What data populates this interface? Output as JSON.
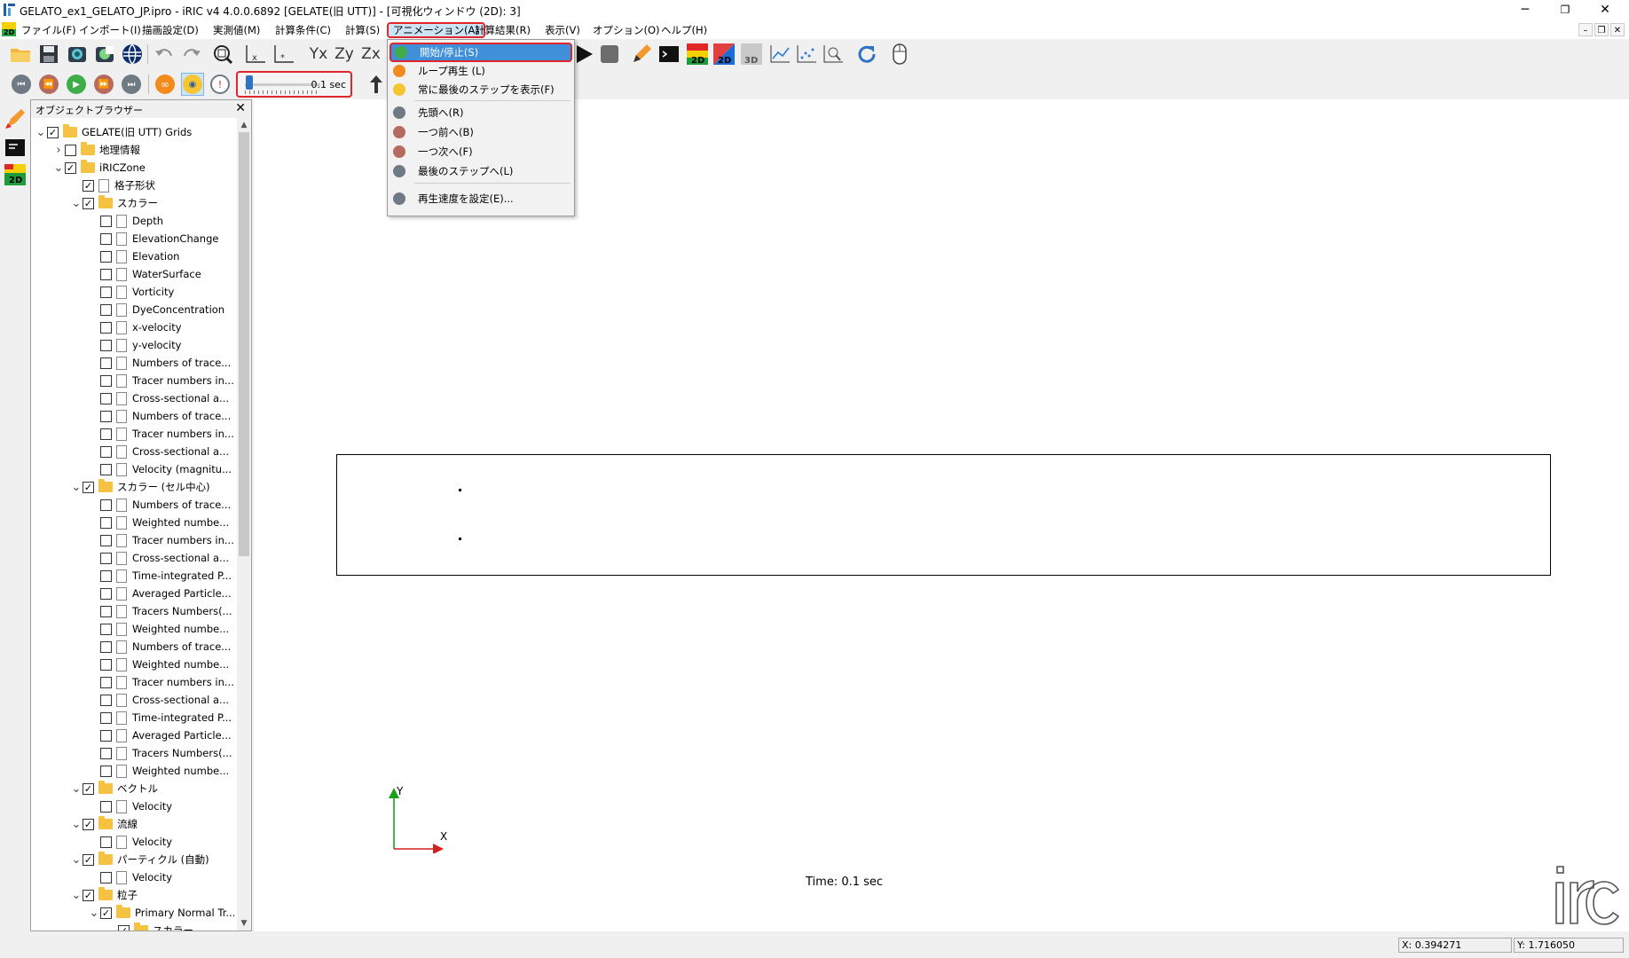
{
  "window": {
    "title": "GELATO_ex1_GELATO_JP.ipro - iRIC v4 4.0.0.6892 [GELATE(旧 UTT)] - [可視化ウィンドウ (2D): 3]",
    "minimize": "─",
    "maximize": "❐",
    "close": "✕"
  },
  "menubar": {
    "items": [
      "ファイル(F)",
      "インポート(I)",
      "描画設定(D)",
      "実測値(M)",
      "計算条件(C)",
      "計算(S)",
      "アニメーション(A)",
      "計算結果(R)",
      "表示(V)",
      "オプション(O)",
      "ヘルプ(H)"
    ],
    "active": "アニメーション(A)",
    "mdi_controls": [
      "–",
      "❐",
      "✕"
    ]
  },
  "toolbar1": {
    "icons": [
      "open-folder-icon",
      "save-icon",
      "snapshot-icon",
      "globe-icon",
      "undo-icon",
      "redo-icon",
      "zoom-fit-icon",
      "axis-icon",
      "axis-edit-icon",
      "yx-icon",
      "zy-icon",
      "zx-icon",
      "play-icon",
      "stop-icon",
      "pencil-icon",
      "console-icon",
      "2d-window-icon",
      "2d-window-alt-icon",
      "3d-window-icon",
      "graph-icon",
      "scatter-icon",
      "zoom-graph-icon",
      "refresh-icon",
      "mouse-icon"
    ],
    "labels": {
      "yx": "Yx",
      "zy": "Zy",
      "zx": "Zx",
      "w2d": "2D",
      "w3d": "3D"
    }
  },
  "toolbar2": {
    "speed_label": "0.1 sec",
    "speed_level": 0.03
  },
  "animation_menu": {
    "items": [
      {
        "label": "開始/停止(S)",
        "icon": "play-icon",
        "color": "#3fae49"
      },
      {
        "label": "ループ再生 (L)",
        "icon": "loop-icon",
        "color": "#f28a1c"
      },
      {
        "label": "常に最後のステップを表示(F)",
        "icon": "eye-icon",
        "color": "#f6c632"
      },
      {
        "label": "先頭へ(R)",
        "icon": "first-step-icon",
        "color": "#6f7a84"
      },
      {
        "label": "一つ前へ(B)",
        "icon": "previous-step-icon",
        "color": "#b56b5f"
      },
      {
        "label": "一つ次へ(F)",
        "icon": "next-step-icon",
        "color": "#b56b5f"
      },
      {
        "label": "最後のステップへ(L)",
        "icon": "last-step-icon",
        "color": "#6f7a84"
      },
      {
        "label": "再生速度を設定(E)...",
        "icon": "clock-icon",
        "color": "#6f7a84"
      }
    ]
  },
  "object_browser": {
    "title": "オブジェクトブラウザー",
    "close": "✕",
    "tree": [
      {
        "label": "GELATE(旧 UTT) Grids",
        "level": 0,
        "expander": "v",
        "checked": true,
        "icon": "folder"
      },
      {
        "label": "地理情報",
        "level": 1,
        "expander": ">",
        "checked": false,
        "icon": "folder"
      },
      {
        "label": "iRICZone",
        "level": 1,
        "expander": "v",
        "checked": true,
        "icon": "folder"
      },
      {
        "label": "格子形状",
        "level": 2,
        "expander": "",
        "checked": true,
        "icon": "doc"
      },
      {
        "label": "スカラー",
        "level": 2,
        "expander": "v",
        "checked": true,
        "icon": "folder"
      },
      {
        "label": "Depth",
        "level": 3,
        "expander": "",
        "checked": false,
        "icon": "doc"
      },
      {
        "label": "ElevationChange",
        "level": 3,
        "expander": "",
        "checked": false,
        "icon": "doc"
      },
      {
        "label": "Elevation",
        "level": 3,
        "expander": "",
        "checked": false,
        "icon": "doc"
      },
      {
        "label": "WaterSurface",
        "level": 3,
        "expander": "",
        "checked": false,
        "icon": "doc"
      },
      {
        "label": "Vorticity",
        "level": 3,
        "expander": "",
        "checked": false,
        "icon": "doc"
      },
      {
        "label": "DyeConcentration",
        "level": 3,
        "expander": "",
        "checked": false,
        "icon": "doc"
      },
      {
        "label": "x-velocity",
        "level": 3,
        "expander": "",
        "checked": false,
        "icon": "doc"
      },
      {
        "label": "y-velocity",
        "level": 3,
        "expander": "",
        "checked": false,
        "icon": "doc"
      },
      {
        "label": "Numbers of trace...",
        "level": 3,
        "expander": "",
        "checked": false,
        "icon": "doc"
      },
      {
        "label": "Tracer numbers in...",
        "level": 3,
        "expander": "",
        "checked": false,
        "icon": "doc"
      },
      {
        "label": "Cross-sectional a...",
        "level": 3,
        "expander": "",
        "checked": false,
        "icon": "doc"
      },
      {
        "label": "Numbers of trace...",
        "level": 3,
        "expander": "",
        "checked": false,
        "icon": "doc"
      },
      {
        "label": "Tracer numbers in...",
        "level": 3,
        "expander": "",
        "checked": false,
        "icon": "doc"
      },
      {
        "label": "Cross-sectional a...",
        "level": 3,
        "expander": "",
        "checked": false,
        "icon": "doc"
      },
      {
        "label": "Velocity (magnitu...",
        "level": 3,
        "expander": "",
        "checked": false,
        "icon": "doc"
      },
      {
        "label": "スカラー (セル中心)",
        "level": 2,
        "expander": "v",
        "checked": true,
        "icon": "folder"
      },
      {
        "label": "Numbers of trace...",
        "level": 3,
        "expander": "",
        "checked": false,
        "icon": "doc"
      },
      {
        "label": "Weighted numbe...",
        "level": 3,
        "expander": "",
        "checked": false,
        "icon": "doc"
      },
      {
        "label": "Tracer numbers in...",
        "level": 3,
        "expander": "",
        "checked": false,
        "icon": "doc"
      },
      {
        "label": "Cross-sectional a...",
        "level": 3,
        "expander": "",
        "checked": false,
        "icon": "doc"
      },
      {
        "label": "Time-integrated P...",
        "level": 3,
        "expander": "",
        "checked": false,
        "icon": "doc"
      },
      {
        "label": "Averaged Particle...",
        "level": 3,
        "expander": "",
        "checked": false,
        "icon": "doc"
      },
      {
        "label": "Tracers Numbers(...",
        "level": 3,
        "expander": "",
        "checked": false,
        "icon": "doc"
      },
      {
        "label": "Weighted numbe...",
        "level": 3,
        "expander": "",
        "checked": false,
        "icon": "doc"
      },
      {
        "label": "Numbers of trace...",
        "level": 3,
        "expander": "",
        "checked": false,
        "icon": "doc"
      },
      {
        "label": "Weighted numbe...",
        "level": 3,
        "expander": "",
        "checked": false,
        "icon": "doc"
      },
      {
        "label": "Tracer numbers in...",
        "level": 3,
        "expander": "",
        "checked": false,
        "icon": "doc"
      },
      {
        "label": "Cross-sectional a...",
        "level": 3,
        "expander": "",
        "checked": false,
        "icon": "doc"
      },
      {
        "label": "Time-integrated P...",
        "level": 3,
        "expander": "",
        "checked": false,
        "icon": "doc"
      },
      {
        "label": "Averaged Particle...",
        "level": 3,
        "expander": "",
        "checked": false,
        "icon": "doc"
      },
      {
        "label": "Tracers Numbers(...",
        "level": 3,
        "expander": "",
        "checked": false,
        "icon": "doc"
      },
      {
        "label": "Weighted numbe...",
        "level": 3,
        "expander": "",
        "checked": false,
        "icon": "doc"
      },
      {
        "label": "ベクトル",
        "level": 2,
        "expander": "v",
        "checked": true,
        "icon": "folder"
      },
      {
        "label": "Velocity",
        "level": 3,
        "expander": "",
        "checked": false,
        "icon": "doc"
      },
      {
        "label": "流線",
        "level": 2,
        "expander": "v",
        "checked": true,
        "icon": "folder"
      },
      {
        "label": "Velocity",
        "level": 3,
        "expander": "",
        "checked": false,
        "icon": "doc"
      },
      {
        "label": "パーティクル (自動)",
        "level": 2,
        "expander": "v",
        "checked": true,
        "icon": "folder"
      },
      {
        "label": "Velocity",
        "level": 3,
        "expander": "",
        "checked": false,
        "icon": "doc"
      },
      {
        "label": "粒子",
        "level": 2,
        "expander": "v",
        "checked": true,
        "icon": "folder"
      },
      {
        "label": "Primary Normal Tr...",
        "level": 3,
        "expander": "v",
        "checked": true,
        "icon": "folder"
      },
      {
        "label": "スカラー",
        "level": 4,
        "expander": "v",
        "checked": true,
        "icon": "folder"
      }
    ]
  },
  "canvas": {
    "time_label": "Time: 0.1 sec",
    "axis_x": "X",
    "axis_y": "Y",
    "logo": "iRIC"
  },
  "statusbar": {
    "x": "X: 0.394271",
    "y": "Y: 1.716050"
  },
  "colors": {
    "highlight_border": "#e0262b",
    "menu_highlight": "#3f8fd9",
    "axis_x": "#d42020",
    "axis_y": "#1aa11a"
  }
}
